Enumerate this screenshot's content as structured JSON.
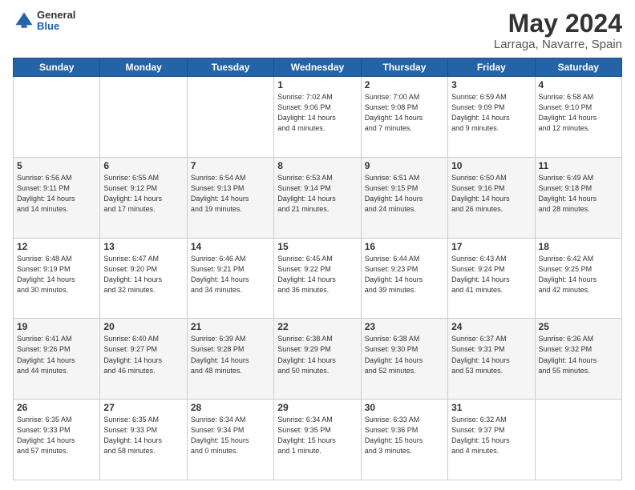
{
  "header": {
    "logo": {
      "general": "General",
      "blue": "Blue"
    },
    "month": "May 2024",
    "location": "Larraga, Navarre, Spain"
  },
  "weekdays": [
    "Sunday",
    "Monday",
    "Tuesday",
    "Wednesday",
    "Thursday",
    "Friday",
    "Saturday"
  ],
  "weeks": [
    [
      {
        "day": "",
        "info": ""
      },
      {
        "day": "",
        "info": ""
      },
      {
        "day": "",
        "info": ""
      },
      {
        "day": "1",
        "info": "Sunrise: 7:02 AM\nSunset: 9:06 PM\nDaylight: 14 hours\nand 4 minutes."
      },
      {
        "day": "2",
        "info": "Sunrise: 7:00 AM\nSunset: 9:08 PM\nDaylight: 14 hours\nand 7 minutes."
      },
      {
        "day": "3",
        "info": "Sunrise: 6:59 AM\nSunset: 9:09 PM\nDaylight: 14 hours\nand 9 minutes."
      },
      {
        "day": "4",
        "info": "Sunrise: 6:58 AM\nSunset: 9:10 PM\nDaylight: 14 hours\nand 12 minutes."
      }
    ],
    [
      {
        "day": "5",
        "info": "Sunrise: 6:56 AM\nSunset: 9:11 PM\nDaylight: 14 hours\nand 14 minutes."
      },
      {
        "day": "6",
        "info": "Sunrise: 6:55 AM\nSunset: 9:12 PM\nDaylight: 14 hours\nand 17 minutes."
      },
      {
        "day": "7",
        "info": "Sunrise: 6:54 AM\nSunset: 9:13 PM\nDaylight: 14 hours\nand 19 minutes."
      },
      {
        "day": "8",
        "info": "Sunrise: 6:53 AM\nSunset: 9:14 PM\nDaylight: 14 hours\nand 21 minutes."
      },
      {
        "day": "9",
        "info": "Sunrise: 6:51 AM\nSunset: 9:15 PM\nDaylight: 14 hours\nand 24 minutes."
      },
      {
        "day": "10",
        "info": "Sunrise: 6:50 AM\nSunset: 9:16 PM\nDaylight: 14 hours\nand 26 minutes."
      },
      {
        "day": "11",
        "info": "Sunrise: 6:49 AM\nSunset: 9:18 PM\nDaylight: 14 hours\nand 28 minutes."
      }
    ],
    [
      {
        "day": "12",
        "info": "Sunrise: 6:48 AM\nSunset: 9:19 PM\nDaylight: 14 hours\nand 30 minutes."
      },
      {
        "day": "13",
        "info": "Sunrise: 6:47 AM\nSunset: 9:20 PM\nDaylight: 14 hours\nand 32 minutes."
      },
      {
        "day": "14",
        "info": "Sunrise: 6:46 AM\nSunset: 9:21 PM\nDaylight: 14 hours\nand 34 minutes."
      },
      {
        "day": "15",
        "info": "Sunrise: 6:45 AM\nSunset: 9:22 PM\nDaylight: 14 hours\nand 36 minutes."
      },
      {
        "day": "16",
        "info": "Sunrise: 6:44 AM\nSunset: 9:23 PM\nDaylight: 14 hours\nand 39 minutes."
      },
      {
        "day": "17",
        "info": "Sunrise: 6:43 AM\nSunset: 9:24 PM\nDaylight: 14 hours\nand 41 minutes."
      },
      {
        "day": "18",
        "info": "Sunrise: 6:42 AM\nSunset: 9:25 PM\nDaylight: 14 hours\nand 42 minutes."
      }
    ],
    [
      {
        "day": "19",
        "info": "Sunrise: 6:41 AM\nSunset: 9:26 PM\nDaylight: 14 hours\nand 44 minutes."
      },
      {
        "day": "20",
        "info": "Sunrise: 6:40 AM\nSunset: 9:27 PM\nDaylight: 14 hours\nand 46 minutes."
      },
      {
        "day": "21",
        "info": "Sunrise: 6:39 AM\nSunset: 9:28 PM\nDaylight: 14 hours\nand 48 minutes."
      },
      {
        "day": "22",
        "info": "Sunrise: 6:38 AM\nSunset: 9:29 PM\nDaylight: 14 hours\nand 50 minutes."
      },
      {
        "day": "23",
        "info": "Sunrise: 6:38 AM\nSunset: 9:30 PM\nDaylight: 14 hours\nand 52 minutes."
      },
      {
        "day": "24",
        "info": "Sunrise: 6:37 AM\nSunset: 9:31 PM\nDaylight: 14 hours\nand 53 minutes."
      },
      {
        "day": "25",
        "info": "Sunrise: 6:36 AM\nSunset: 9:32 PM\nDaylight: 14 hours\nand 55 minutes."
      }
    ],
    [
      {
        "day": "26",
        "info": "Sunrise: 6:35 AM\nSunset: 9:33 PM\nDaylight: 14 hours\nand 57 minutes."
      },
      {
        "day": "27",
        "info": "Sunrise: 6:35 AM\nSunset: 9:33 PM\nDaylight: 14 hours\nand 58 minutes."
      },
      {
        "day": "28",
        "info": "Sunrise: 6:34 AM\nSunset: 9:34 PM\nDaylight: 15 hours\nand 0 minutes."
      },
      {
        "day": "29",
        "info": "Sunrise: 6:34 AM\nSunset: 9:35 PM\nDaylight: 15 hours\nand 1 minute."
      },
      {
        "day": "30",
        "info": "Sunrise: 6:33 AM\nSunset: 9:36 PM\nDaylight: 15 hours\nand 3 minutes."
      },
      {
        "day": "31",
        "info": "Sunrise: 6:32 AM\nSunset: 9:37 PM\nDaylight: 15 hours\nand 4 minutes."
      },
      {
        "day": "",
        "info": ""
      }
    ]
  ]
}
